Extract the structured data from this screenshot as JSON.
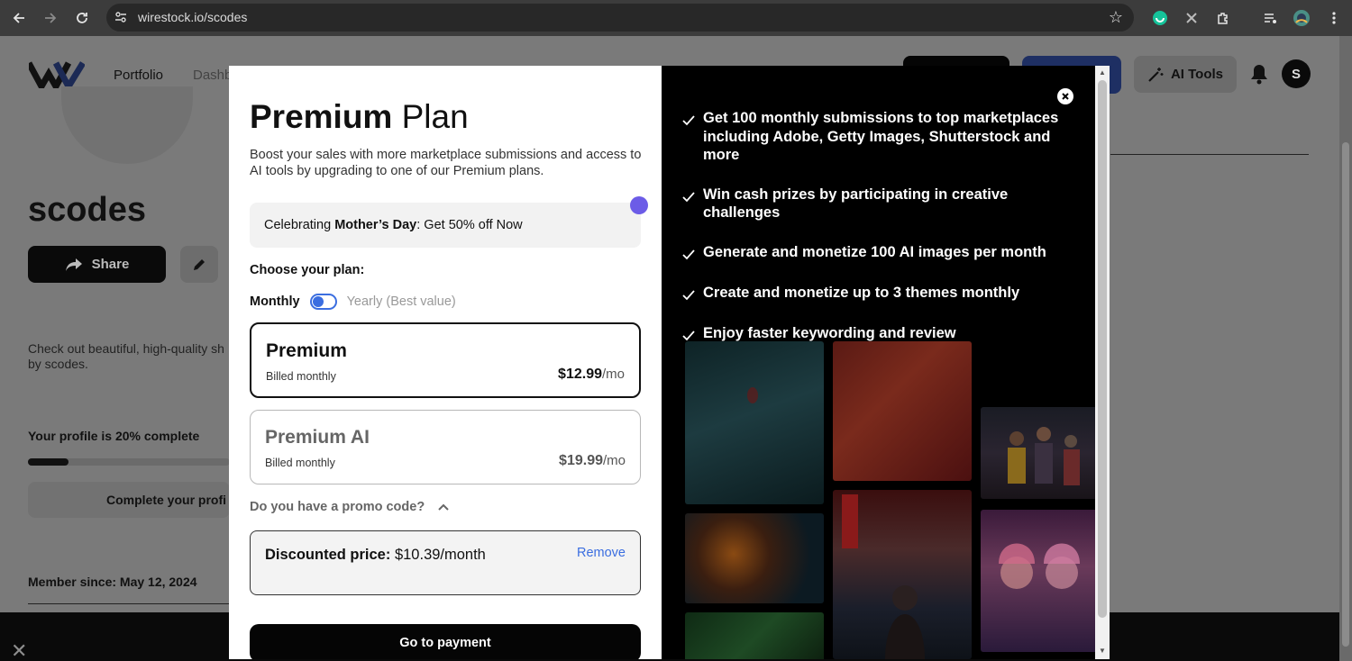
{
  "browser": {
    "url": "wirestock.io/scodes"
  },
  "background": {
    "nav_portfolio": "Portfolio",
    "nav_dashboard": "Dashb",
    "username": "scodes",
    "share_label": "Share",
    "description": "Check out beautiful, high-quality sh by scodes.",
    "profile_progress_label": "Your profile is 20% complete",
    "profile_progress": 0.2,
    "complete_profile_label": "Complete your profi",
    "member_since": "Member since: May 12, 2024",
    "ai_tools_label": "AI Tools",
    "user_initial": "S"
  },
  "modal": {
    "title_bold": "Premium",
    "title_rest": "Plan",
    "subtitle": "Boost your sales with more marketplace submissions and access to AI tools by upgrading to one of our Premium plans.",
    "promo_banner": {
      "prefix": "Celebrating ",
      "bold": "Mother’s Day",
      "suffix": ": Get 50% off Now"
    },
    "choose_label": "Choose your plan:",
    "billing": {
      "monthly": "Monthly",
      "yearly": "Yearly (Best value)",
      "selected": "Monthly"
    },
    "plans": [
      {
        "name": "Premium",
        "billing": "Billed monthly",
        "price": "$12.99",
        "per": "/mo",
        "selected": true
      },
      {
        "name": "Premium AI",
        "billing": "Billed monthly",
        "price": "$19.99",
        "per": "/mo",
        "selected": false
      }
    ],
    "promo_question": "Do you have a promo code?",
    "discount": {
      "label": "Discounted price:",
      "value": "$10.39/month",
      "remove": "Remove"
    },
    "pay_button": "Go to payment",
    "features": [
      "Get 100 monthly submissions to top marketplaces including Adobe, Getty Images, Shutterstock and more",
      "Win cash prizes by participating in creative challenges",
      "Generate and monetize 100 AI images per month",
      "Create and monetize up to 3 themes monthly",
      "Enjoy faster keywording and review"
    ]
  },
  "colors": {
    "accent_blue": "#3b6ee0",
    "promo_dot": "#6c5ce7",
    "dark": "#050505"
  }
}
